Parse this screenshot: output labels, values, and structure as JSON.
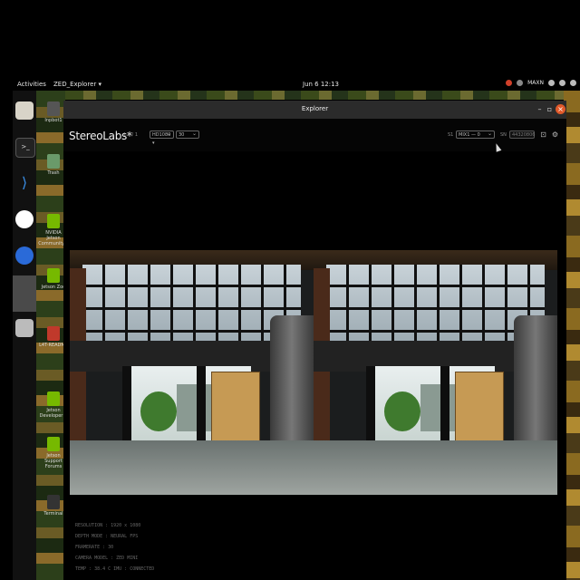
{
  "topbar": {
    "activities": "Activities",
    "app_menu": "ZED_Explorer ▾",
    "clock": "Jun 6  12:13",
    "user": "MAXN"
  },
  "desktop_icons": [
    {
      "label": "Inpbot1",
      "color": "#555555"
    },
    {
      "label": "Trash",
      "color": "#6a9a6a"
    },
    {
      "label": "NVIDIA Jetson Community F",
      "color": "#76b900"
    },
    {
      "label": "Jetson Zoo",
      "color": "#76b900"
    },
    {
      "label": "L4T-README",
      "color": "#c0392b"
    },
    {
      "label": "Jetson Developer Z",
      "color": "#76b900"
    },
    {
      "label": "Jetson Support Forums",
      "color": "#76b900"
    },
    {
      "label": "Terminal",
      "color": "#333333"
    }
  ],
  "window": {
    "title": "Explorer",
    "brand": "StereoLabs*",
    "fps_label": "1.5 / 1",
    "resolution": "HD1080 ▾",
    "fps_select": "30",
    "sn_left_label": "S1",
    "camera_select": "MIX1 — 0",
    "sn_label": "SN",
    "sn_value": "44320806"
  },
  "info_lines": [
    "RESOLUTION : 1920 x 1080",
    "DEPTH MODE : NEURAL    FPS",
    "FRAMERATE : 30",
    "CAMERA MODEL : ZED MINI",
    "TEMP : 38.4 C    IMU : CONNECTED"
  ],
  "colors": {
    "accent": "#e0592a",
    "titlebar": "#2b2b2b"
  }
}
